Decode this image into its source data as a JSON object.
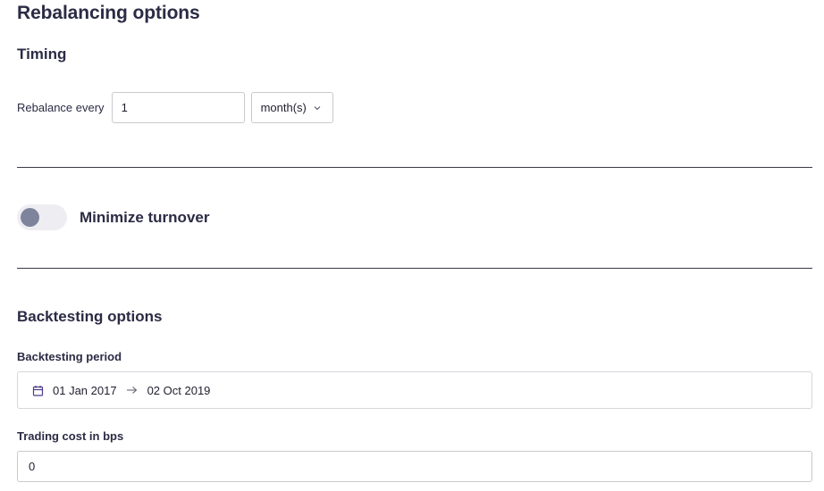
{
  "rebalancing": {
    "title": "Rebalancing options",
    "timing_heading": "Timing",
    "rebalance_label": "Rebalance every",
    "rebalance_value": "1",
    "period_unit": "month(s)"
  },
  "turnover": {
    "label": "Minimize turnover",
    "enabled": false
  },
  "backtesting": {
    "heading": "Backtesting options",
    "period_label": "Backtesting period",
    "start_date": "01 Jan 2017",
    "end_date": "02 Oct 2019",
    "cost_label": "Trading cost in bps",
    "cost_value": "0"
  },
  "icons": {
    "period_chevron": "chevron-down-icon",
    "calendar": "calendar-icon",
    "range_arrow": "arrow-right-icon"
  },
  "colors": {
    "heading_text": "#2b2b45",
    "toggle_off_track": "#eeeef2",
    "toggle_off_knob": "#7e849b",
    "calendar_accent": "#4b3a8c"
  }
}
